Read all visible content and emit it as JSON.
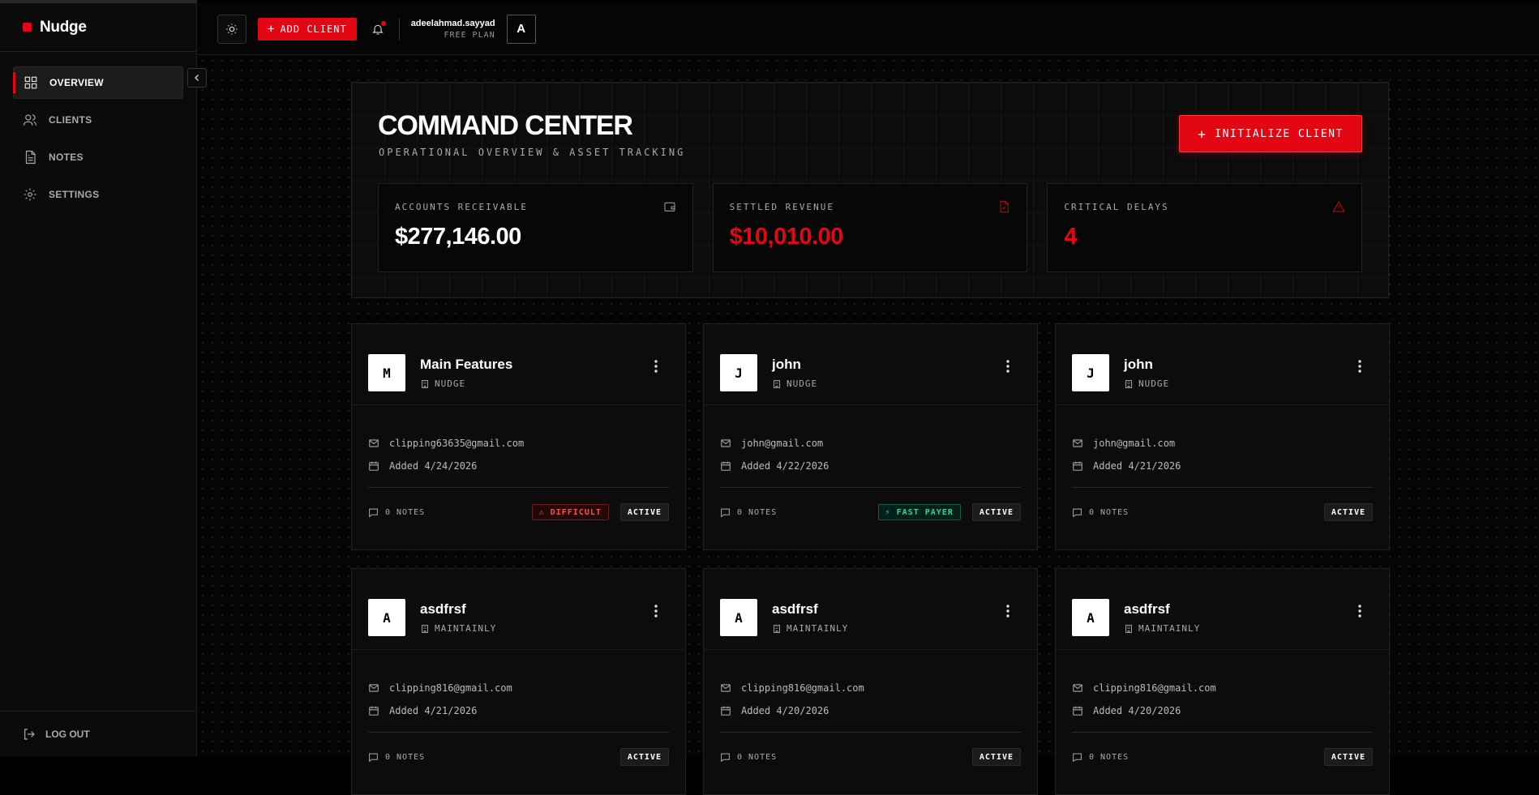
{
  "brand": {
    "name": "Nudge",
    "accent": "#e30613"
  },
  "sidebar": {
    "items": [
      {
        "label": "OVERVIEW",
        "icon": "grid-icon",
        "active": true
      },
      {
        "label": "CLIENTS",
        "icon": "users-icon",
        "active": false
      },
      {
        "label": "NOTES",
        "icon": "file-text-icon",
        "active": false
      },
      {
        "label": "SETTINGS",
        "icon": "gear-icon",
        "active": false
      }
    ],
    "logout_label": "LOG OUT"
  },
  "topbar": {
    "add_client_label": "ADD CLIENT",
    "user_name": "adeelahmad.sayyad",
    "user_plan": "FREE PLAN",
    "avatar_initial": "A"
  },
  "hero": {
    "title": "COMMAND CENTER",
    "subtitle": "OPERATIONAL OVERVIEW & ASSET TRACKING",
    "init_button": "INITIALIZE CLIENT",
    "stats": [
      {
        "label": "ACCOUNTS RECEIVABLE",
        "value": "$277,146.00",
        "icon": "wallet-icon"
      },
      {
        "label": "SETTLED REVENUE",
        "value": "$10,010.00",
        "icon": "file-check-icon"
      },
      {
        "label": "CRITICAL DELAYS",
        "value": "4",
        "icon": "alert-triangle-icon"
      }
    ]
  },
  "clients": [
    {
      "initial": "M",
      "name": "Main Features",
      "company": "NUDGE",
      "email": "clipping63635@gmail.com",
      "added": "Added 4/24/2026",
      "notes": "0 NOTES",
      "tag": "⚠ DIFFICULT",
      "tag_type": "difficult",
      "status": "ACTIVE"
    },
    {
      "initial": "J",
      "name": "john",
      "company": "NUDGE",
      "email": "john@gmail.com",
      "added": "Added 4/22/2026",
      "notes": "0 NOTES",
      "tag": "⚡ FAST PAYER",
      "tag_type": "fast",
      "status": "ACTIVE"
    },
    {
      "initial": "J",
      "name": "john",
      "company": "NUDGE",
      "email": "john@gmail.com",
      "added": "Added 4/21/2026",
      "notes": "0 NOTES",
      "tag": "",
      "tag_type": "",
      "status": "ACTIVE"
    },
    {
      "initial": "A",
      "name": "asdfrsf",
      "company": "MAINTAINLY",
      "email": "clipping816@gmail.com",
      "added": "Added 4/21/2026",
      "notes": "0 NOTES",
      "tag": "",
      "tag_type": "",
      "status": "ACTIVE"
    },
    {
      "initial": "A",
      "name": "asdfrsf",
      "company": "MAINTAINLY",
      "email": "clipping816@gmail.com",
      "added": "Added 4/20/2026",
      "notes": "0 NOTES",
      "tag": "",
      "tag_type": "",
      "status": "ACTIVE"
    },
    {
      "initial": "A",
      "name": "asdfrsf",
      "company": "MAINTAINLY",
      "email": "clipping816@gmail.com",
      "added": "Added 4/20/2026",
      "notes": "0 NOTES",
      "tag": "",
      "tag_type": "",
      "status": "ACTIVE"
    }
  ]
}
